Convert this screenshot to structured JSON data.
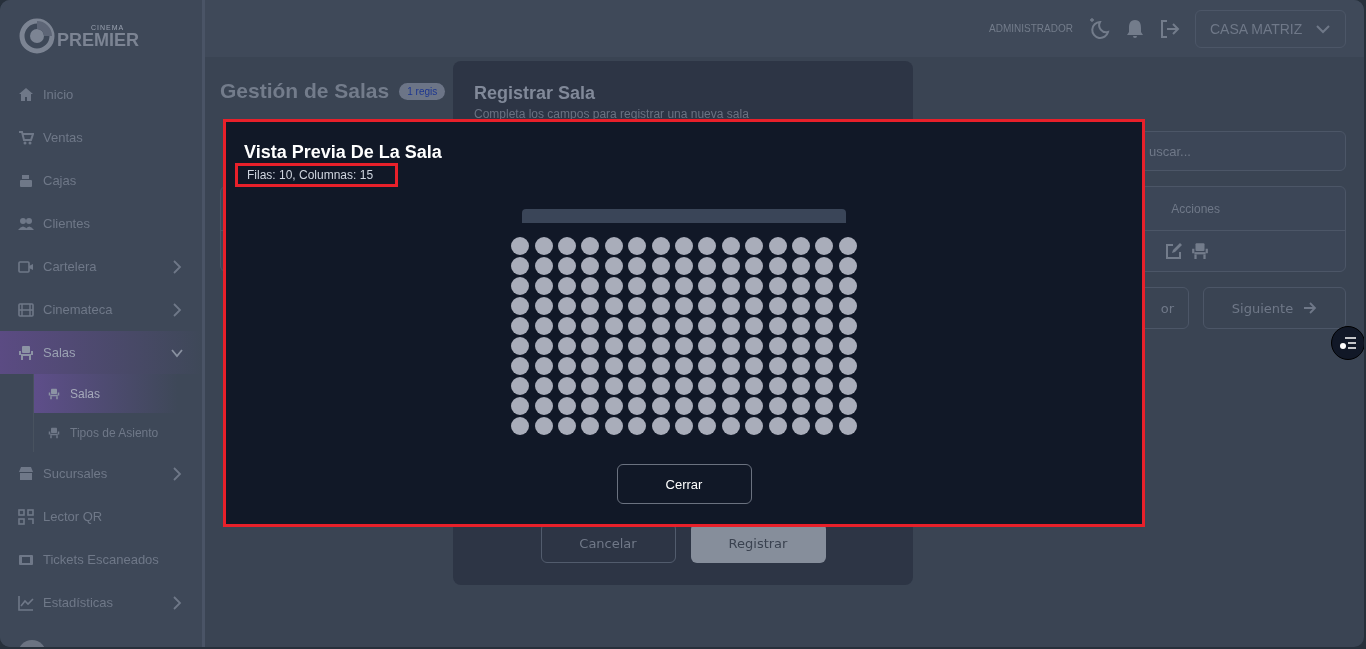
{
  "sidebar": {
    "logo": {
      "tagline": "CINEMA",
      "name": "PREMIER"
    },
    "items": [
      {
        "label": "Inicio",
        "expandable": false,
        "selected": false
      },
      {
        "label": "Ventas",
        "expandable": false,
        "selected": false
      },
      {
        "label": "Cajas",
        "expandable": false,
        "selected": false
      },
      {
        "label": "Clientes",
        "expandable": false,
        "selected": false
      },
      {
        "label": "Cartelera",
        "expandable": true,
        "expanded": false,
        "selected": false
      },
      {
        "label": "Cinemateca",
        "expandable": true,
        "expanded": false,
        "selected": false
      },
      {
        "label": "Salas",
        "expandable": true,
        "expanded": true,
        "selected": true,
        "children": [
          {
            "label": "Salas",
            "selected": true
          },
          {
            "label": "Tipos de Asiento",
            "selected": false
          }
        ]
      },
      {
        "label": "Sucursales",
        "expandable": true,
        "expanded": false,
        "selected": false
      },
      {
        "label": "Lector QR",
        "expandable": false,
        "selected": false
      },
      {
        "label": "Tickets Escaneados",
        "expandable": false,
        "selected": false
      },
      {
        "label": "Estadísticas",
        "expandable": true,
        "expanded": false,
        "selected": false
      }
    ]
  },
  "header": {
    "role": "ADMINISTRADOR",
    "branch": "CASA MATRIZ"
  },
  "page": {
    "title": "Gestión de Salas",
    "count_badge": "1 regis",
    "search": {
      "placeholder": "uscar..."
    },
    "table": {
      "columns": [
        "Acciones"
      ]
    },
    "pagination": {
      "previous": "or",
      "next": "Siguiente"
    }
  },
  "register_dialog": {
    "title": "Registrar Sala",
    "subtitle": "Completa los campos para registrar una nueva sala",
    "buttons": [
      {
        "label": "Cancelar",
        "kind": "secondary"
      },
      {
        "label": "Registrar",
        "kind": "primary"
      }
    ]
  },
  "preview_dialog": {
    "title": "Vista Previa De La Sala",
    "summary": "Filas: 10, Columnas: 15",
    "close_button": "Cerrar",
    "highlighted": true,
    "summary_highlighted": true,
    "seat_rows": [
      {
        "seats": [
          {
            "kind": "seat"
          },
          {
            "kind": "seat"
          },
          {
            "kind": "seat"
          },
          {
            "kind": "seat"
          },
          {
            "kind": "seat"
          },
          {
            "kind": "seat"
          },
          {
            "kind": "seat"
          },
          {
            "kind": "seat"
          },
          {
            "kind": "seat"
          },
          {
            "kind": "seat"
          },
          {
            "kind": "seat"
          },
          {
            "kind": "seat"
          },
          {
            "kind": "seat"
          },
          {
            "kind": "seat"
          },
          {
            "kind": "seat"
          }
        ]
      },
      {
        "seats": [
          {
            "kind": "seat"
          },
          {
            "kind": "seat"
          },
          {
            "kind": "seat"
          },
          {
            "kind": "seat"
          },
          {
            "kind": "seat"
          },
          {
            "kind": "seat"
          },
          {
            "kind": "seat"
          },
          {
            "kind": "seat"
          },
          {
            "kind": "seat"
          },
          {
            "kind": "seat"
          },
          {
            "kind": "seat"
          },
          {
            "kind": "seat"
          },
          {
            "kind": "seat"
          },
          {
            "kind": "seat"
          },
          {
            "kind": "seat"
          }
        ]
      },
      {
        "seats": [
          {
            "kind": "seat"
          },
          {
            "kind": "seat"
          },
          {
            "kind": "seat"
          },
          {
            "kind": "seat"
          },
          {
            "kind": "seat"
          },
          {
            "kind": "seat"
          },
          {
            "kind": "seat"
          },
          {
            "kind": "seat"
          },
          {
            "kind": "seat"
          },
          {
            "kind": "seat"
          },
          {
            "kind": "seat"
          },
          {
            "kind": "seat"
          },
          {
            "kind": "seat"
          },
          {
            "kind": "seat"
          },
          {
            "kind": "seat"
          }
        ]
      },
      {
        "seats": [
          {
            "kind": "seat"
          },
          {
            "kind": "seat"
          },
          {
            "kind": "seat"
          },
          {
            "kind": "seat"
          },
          {
            "kind": "seat"
          },
          {
            "kind": "seat"
          },
          {
            "kind": "seat"
          },
          {
            "kind": "seat"
          },
          {
            "kind": "seat"
          },
          {
            "kind": "seat"
          },
          {
            "kind": "seat"
          },
          {
            "kind": "seat"
          },
          {
            "kind": "seat"
          },
          {
            "kind": "seat"
          },
          {
            "kind": "seat"
          }
        ]
      },
      {
        "seats": [
          {
            "kind": "seat"
          },
          {
            "kind": "seat"
          },
          {
            "kind": "seat"
          },
          {
            "kind": "seat"
          },
          {
            "kind": "seat"
          },
          {
            "kind": "seat"
          },
          {
            "kind": "seat"
          },
          {
            "kind": "seat"
          },
          {
            "kind": "seat"
          },
          {
            "kind": "seat"
          },
          {
            "kind": "seat"
          },
          {
            "kind": "seat"
          },
          {
            "kind": "seat"
          },
          {
            "kind": "seat"
          },
          {
            "kind": "seat"
          }
        ]
      },
      {
        "seats": [
          {
            "kind": "seat"
          },
          {
            "kind": "seat"
          },
          {
            "kind": "seat"
          },
          {
            "kind": "seat"
          },
          {
            "kind": "seat"
          },
          {
            "kind": "seat"
          },
          {
            "kind": "seat"
          },
          {
            "kind": "seat"
          },
          {
            "kind": "seat"
          },
          {
            "kind": "seat"
          },
          {
            "kind": "seat"
          },
          {
            "kind": "seat"
          },
          {
            "kind": "seat"
          },
          {
            "kind": "seat"
          },
          {
            "kind": "seat"
          }
        ]
      },
      {
        "seats": [
          {
            "kind": "seat"
          },
          {
            "kind": "seat"
          },
          {
            "kind": "seat"
          },
          {
            "kind": "seat"
          },
          {
            "kind": "seat"
          },
          {
            "kind": "seat"
          },
          {
            "kind": "seat"
          },
          {
            "kind": "seat"
          },
          {
            "kind": "seat"
          },
          {
            "kind": "seat"
          },
          {
            "kind": "seat"
          },
          {
            "kind": "seat"
          },
          {
            "kind": "seat"
          },
          {
            "kind": "seat"
          },
          {
            "kind": "seat"
          }
        ]
      },
      {
        "seats": [
          {
            "kind": "seat"
          },
          {
            "kind": "seat"
          },
          {
            "kind": "seat"
          },
          {
            "kind": "seat"
          },
          {
            "kind": "seat"
          },
          {
            "kind": "seat"
          },
          {
            "kind": "seat"
          },
          {
            "kind": "seat"
          },
          {
            "kind": "seat"
          },
          {
            "kind": "seat"
          },
          {
            "kind": "seat"
          },
          {
            "kind": "seat"
          },
          {
            "kind": "seat"
          },
          {
            "kind": "seat"
          },
          {
            "kind": "seat"
          }
        ]
      },
      {
        "seats": [
          {
            "kind": "seat"
          },
          {
            "kind": "seat"
          },
          {
            "kind": "seat"
          },
          {
            "kind": "seat"
          },
          {
            "kind": "seat"
          },
          {
            "kind": "seat"
          },
          {
            "kind": "seat"
          },
          {
            "kind": "seat"
          },
          {
            "kind": "seat"
          },
          {
            "kind": "seat"
          },
          {
            "kind": "seat"
          },
          {
            "kind": "seat"
          },
          {
            "kind": "seat"
          },
          {
            "kind": "seat"
          },
          {
            "kind": "seat"
          }
        ]
      },
      {
        "seats": [
          {
            "kind": "seat"
          },
          {
            "kind": "seat"
          },
          {
            "kind": "seat"
          },
          {
            "kind": "seat"
          },
          {
            "kind": "seat"
          },
          {
            "kind": "seat"
          },
          {
            "kind": "seat"
          },
          {
            "kind": "seat"
          },
          {
            "kind": "seat"
          },
          {
            "kind": "seat"
          },
          {
            "kind": "seat"
          },
          {
            "kind": "seat"
          },
          {
            "kind": "seat"
          },
          {
            "kind": "seat"
          },
          {
            "kind": "seat"
          }
        ]
      }
    ]
  }
}
